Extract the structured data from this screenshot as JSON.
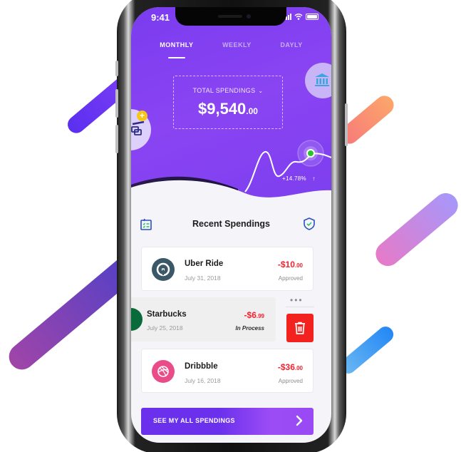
{
  "status_bar": {
    "time": "9:41"
  },
  "tabs": [
    {
      "label": "MONTHLY",
      "active": true
    },
    {
      "label": "WEEKLY",
      "active": false
    },
    {
      "label": "DAYLY",
      "active": false
    }
  ],
  "summary": {
    "label": "TOTAL SPENDINGS",
    "amount_main": "$9,540",
    "amount_cents": ".00",
    "growth": "+14.78%",
    "growth_arrow": "↑"
  },
  "quick_actions": {
    "add_badge": "+"
  },
  "recent": {
    "title": "Recent Spendings",
    "items": [
      {
        "name": "Uber Ride",
        "date": "July 31, 2018",
        "amount_main": "-$10",
        "amount_cents": ".00",
        "status": "Approved",
        "color": "#3a5868"
      },
      {
        "name": "Starbucks",
        "date": "July 25, 2018",
        "amount_main": "-$6",
        "amount_cents": ".99",
        "status": "In Process",
        "color": "#0a6b3a"
      },
      {
        "name": "Dribbble",
        "date": "July 16, 2018",
        "amount_main": "-$36",
        "amount_cents": ".00",
        "status": "Approved",
        "color": "#ea4c89"
      }
    ],
    "more_dots": "•••"
  },
  "cta": {
    "label": "SEE MY ALL SPENDINGS"
  },
  "colors": {
    "brand": "#7a3cf0",
    "negative": "#f5222d",
    "positive_dot": "#2bc42b",
    "delete": "#f4221e"
  }
}
